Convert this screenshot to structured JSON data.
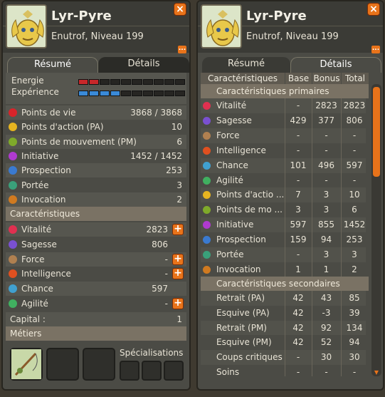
{
  "left": {
    "name": "Lyr-Pyre",
    "subtitle": "Enutrof, Niveau 199",
    "tabs": [
      "Résumé",
      "Détails"
    ],
    "energy_label": "Energie",
    "exp_label": "Expérience",
    "energy_fraction": 0.12,
    "exp_fraction": 0.35,
    "stats": [
      {
        "label": "Points de vie",
        "value": "3868 / 3868",
        "icon": "heart-icon",
        "color": "#d8242a"
      },
      {
        "label": "Points d'action (PA)",
        "value": "10",
        "icon": "star-icon",
        "color": "#e6b420"
      },
      {
        "label": "Points de mouvement (PM)",
        "value": "6",
        "icon": "boot-icon",
        "color": "#7faa2a"
      },
      {
        "label": "Initiative",
        "value": "1452 / 1452",
        "icon": "initiative-icon",
        "color": "#b03ad0"
      },
      {
        "label": "Prospection",
        "value": "253",
        "icon": "prospection-icon",
        "color": "#3a7ad0"
      },
      {
        "label": "Portée",
        "value": "3",
        "icon": "range-icon",
        "color": "#3aa07a"
      },
      {
        "label": "Invocation",
        "value": "2",
        "icon": "invocation-icon",
        "color": "#d07a20"
      }
    ],
    "characteristics_title": "Caractéristiques",
    "characteristics": [
      {
        "label": "Vitalité",
        "value": "2823",
        "icon": "vitality-icon",
        "color": "#e03050"
      },
      {
        "label": "Sagesse",
        "value": "806",
        "icon": "wisdom-icon",
        "color": "#7a50d0"
      },
      {
        "label": "Force",
        "value": "-",
        "icon": "strength-icon",
        "color": "#b08050"
      },
      {
        "label": "Intelligence",
        "value": "-",
        "icon": "intelligence-icon",
        "color": "#e05020"
      },
      {
        "label": "Chance",
        "value": "597",
        "icon": "chance-icon",
        "color": "#40a0d0"
      },
      {
        "label": "Agilité",
        "value": "-",
        "icon": "agility-icon",
        "color": "#40b060"
      }
    ],
    "plus_symbol": "+",
    "capital_label": "Capital :",
    "capital_value": "1",
    "jobs_title": "Métiers",
    "specializations_label": "Spécialisations",
    "close_symbol": "×",
    "more_symbol": "..."
  },
  "right": {
    "name": "Lyr-Pyre",
    "subtitle": "Enutrof, Niveau 199",
    "tabs": [
      "Résumé",
      "Détails"
    ],
    "columns": [
      "Caractéristiques",
      "Base",
      "Bonus",
      "Total"
    ],
    "primary_title": "Caractéristiques primaires",
    "primary": [
      {
        "label": "Vitalité",
        "base": "-",
        "bonus": "2823",
        "total": "2823",
        "icon": "vitality-icon",
        "color": "#e03050"
      },
      {
        "label": "Sagesse",
        "base": "429",
        "bonus": "377",
        "total": "806",
        "icon": "wisdom-icon",
        "color": "#7a50d0"
      },
      {
        "label": "Force",
        "base": "-",
        "bonus": "-",
        "total": "-",
        "icon": "strength-icon",
        "color": "#b08050"
      },
      {
        "label": "Intelligence",
        "base": "-",
        "bonus": "-",
        "total": "-",
        "icon": "intelligence-icon",
        "color": "#e05020"
      },
      {
        "label": "Chance",
        "base": "101",
        "bonus": "496",
        "total": "597",
        "icon": "chance-icon",
        "color": "#40a0d0"
      },
      {
        "label": "Agilité",
        "base": "-",
        "bonus": "-",
        "total": "-",
        "icon": "agility-icon",
        "color": "#40b060"
      },
      {
        "label": "Points d'actio ...",
        "base": "7",
        "bonus": "3",
        "total": "10",
        "icon": "star-icon",
        "color": "#e6b420"
      },
      {
        "label": "Points de mo ...",
        "base": "3",
        "bonus": "3",
        "total": "6",
        "icon": "boot-icon",
        "color": "#7faa2a"
      },
      {
        "label": "Initiative",
        "base": "597",
        "bonus": "855",
        "total": "1452",
        "icon": "initiative-icon",
        "color": "#b03ad0"
      },
      {
        "label": "Prospection",
        "base": "159",
        "bonus": "94",
        "total": "253",
        "icon": "prospection-icon",
        "color": "#3a7ad0"
      },
      {
        "label": "Portée",
        "base": "-",
        "bonus": "3",
        "total": "3",
        "icon": "range-icon",
        "color": "#3aa07a"
      },
      {
        "label": "Invocation",
        "base": "1",
        "bonus": "1",
        "total": "2",
        "icon": "invocation-icon",
        "color": "#d07a20"
      }
    ],
    "secondary_title": "Caractéristiques secondaires",
    "secondary": [
      {
        "label": "Retrait (PA)",
        "base": "42",
        "bonus": "43",
        "total": "85"
      },
      {
        "label": "Esquive (PA)",
        "base": "42",
        "bonus": "-3",
        "total": "39"
      },
      {
        "label": "Retrait (PM)",
        "base": "42",
        "bonus": "92",
        "total": "134"
      },
      {
        "label": "Esquive (PM)",
        "base": "42",
        "bonus": "52",
        "total": "94"
      },
      {
        "label": "Coups critiques",
        "base": "-",
        "bonus": "30",
        "total": "30"
      },
      {
        "label": "Soins",
        "base": "-",
        "bonus": "-",
        "total": "-"
      }
    ],
    "close_symbol": "×",
    "more_symbol": "..."
  }
}
